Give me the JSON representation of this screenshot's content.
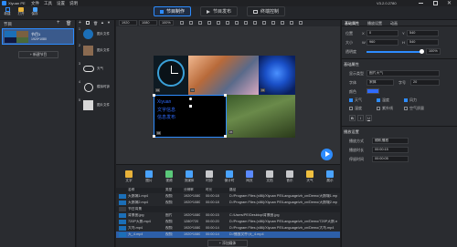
{
  "app": {
    "title": "Xiyuan PE",
    "version": "V3.2.0.2780"
  },
  "menu": {
    "file": "文件",
    "tools": "工具",
    "settings": "设置",
    "help": "说明"
  },
  "toolbar_left": {
    "new": "新建",
    "save": "打开",
    "open": "保存"
  },
  "top_tabs": [
    {
      "label": "节目制作"
    },
    {
      "label": "节目发布"
    },
    {
      "label": "终端控制"
    }
  ],
  "program_panel": {
    "header": "节目",
    "item_label": "节目1",
    "item_res": "1920*1080",
    "new_button": "+ 新建节目"
  },
  "pages": [
    {
      "num": "1",
      "label": "图片文件"
    },
    {
      "num": "2",
      "label": "图片文件"
    },
    {
      "num": "3",
      "label": "天气"
    },
    {
      "num": "4",
      "label": "模拟时钟"
    },
    {
      "num": "5",
      "label": "图片文件"
    }
  ],
  "canvas_toolbar": {
    "width": "1920",
    "height": "1080",
    "zoom": "100%"
  },
  "canvas_text": {
    "line1": "Xiyuan",
    "line2": "文字信息",
    "line3": "信息发布"
  },
  "canvas_labels": [
    "01",
    "02",
    "03",
    "04",
    "05"
  ],
  "media_tools": [
    "文字",
    "图片",
    "视频",
    "流媒体",
    "时钟",
    "倒计时",
    "网页",
    "文档",
    "音乐",
    "天气",
    "展示"
  ],
  "table": {
    "headers": [
      "名称",
      "类型",
      "分辨率",
      "时长",
      "路径"
    ],
    "rows": [
      {
        "name": "天鹅城1.mp4",
        "type": "视频",
        "res": "1920*1080",
        "dur": "00:00:18",
        "path": "D:/Program Files (x86)/Xiyuan PE/Language/zh_cn/Demo/天鹅城1.mp4",
        "section": false
      },
      {
        "name": "天鹅城2.mp4",
        "type": "视频",
        "res": "1920*1080",
        "dur": "00:00:18",
        "path": "D:/Program Files (x86)/Xiyuan PE/Language/zh_cn/Demo/天鹅城2.mp4",
        "section": false
      },
      {
        "name": "节目背景",
        "type": "",
        "res": "",
        "dur": "",
        "path": "",
        "section": true
      },
      {
        "name": "背景图.jpg",
        "type": "图片",
        "res": "1920*1080",
        "dur": "00:00:15",
        "path": "C:/Users/PE/Desktop/背景图.jpg",
        "section": false
      },
      {
        "name": "720P天鹅.mp4",
        "type": "视频",
        "res": "1280*720",
        "dur": "00:00:20",
        "path": "D:/Program Files (x86)/Xiyuan PE/Language/zh_cn/Demo/720P天鹅.mp4",
        "section": false
      },
      {
        "name": "大鸟.mp4",
        "type": "视频",
        "res": "1920*1080",
        "dur": "00:00:14",
        "path": "D:/Program Files (x86)/Xiyuan PE/Language/zh_cn/Demo/大鸟.mp4",
        "section": false
      },
      {
        "name": "天_4.mp4",
        "type": "视频",
        "res": "1920*1080",
        "dur": "00:00:14",
        "path": "D:/播放文件/天_4.mp4",
        "section": false
      }
    ],
    "add_button": "+ 添加媒体"
  },
  "props": {
    "tabs": [
      "基础属性",
      "播放设置",
      "动画"
    ],
    "position_label": "位置",
    "size_label": "大小",
    "x_label": "X",
    "x": "0",
    "y_label": "Y",
    "y": "540",
    "w_label": "W",
    "w": "960",
    "h_label": "H",
    "h": "540",
    "opacity_label": "透明度",
    "opacity": "100%",
    "basic_section": "基础属性",
    "type_label": "显示类型",
    "type_value": "图片天气",
    "font_label": "字体",
    "font_value": "宋体",
    "size2_label": "字号",
    "size2_value": "20",
    "color_label": "颜色",
    "chk_weather": "天气",
    "chk_temp": "温度",
    "chk_wind": "风力",
    "chk_humid": "湿度",
    "chk_uv": "紫外线",
    "chk_aqi": "空气质量",
    "fmt_buttons": [
      "B",
      "I",
      "U"
    ],
    "play_section": "播放设置",
    "mode_label": "播放方式",
    "mode_value": "随机播放",
    "dur_label": "播放时长",
    "dur_value": "00:00:15",
    "stay_label": "停留时间",
    "stay_value": "00:00:05"
  },
  "colors": {
    "accent": "#2d8cff",
    "canvas_text": "#2f6bff",
    "selection": "#2d8cff"
  }
}
